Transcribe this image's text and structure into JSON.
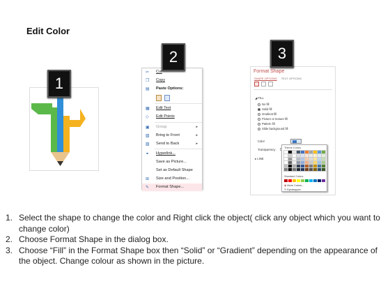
{
  "title": "Edit Color",
  "steps": [
    "1",
    "2",
    "3"
  ],
  "menu": {
    "items": [
      {
        "label": "Cut",
        "icon": "scissors-icon",
        "glyph": "✂",
        "style": "u"
      },
      {
        "label": "Copy",
        "icon": "copy-icon",
        "glyph": "❐",
        "style": "u"
      },
      {
        "label": "Paste Options:",
        "icon": "paste-icon",
        "glyph": "▤",
        "style": "title"
      },
      {
        "label": "Edit Text",
        "icon": "edit-text-icon",
        "glyph": "▦",
        "style": "u"
      },
      {
        "label": "Edit Points",
        "icon": "edit-points-icon",
        "glyph": "◇",
        "style": "u"
      },
      {
        "label": "Group",
        "icon": "group-icon",
        "glyph": "▣",
        "style": "dim",
        "arrow": true
      },
      {
        "label": "Bring to Front",
        "icon": "bring-to-front-icon",
        "glyph": "▧",
        "style": "",
        "arrow": true
      },
      {
        "label": "Send to Back",
        "icon": "send-to-back-icon",
        "glyph": "▨",
        "style": "",
        "arrow": true
      },
      {
        "label": "Hyperlink...",
        "icon": "hyperlink-icon",
        "glyph": "⚭",
        "style": "u"
      },
      {
        "label": "Save as Picture...",
        "icon": "",
        "glyph": "",
        "style": ""
      },
      {
        "label": "Set as Default Shape",
        "icon": "",
        "glyph": "",
        "style": ""
      },
      {
        "label": "Size and Position...",
        "icon": "size-position-icon",
        "glyph": "⊞",
        "style": ""
      },
      {
        "label": "Format Shape...",
        "icon": "format-shape-icon",
        "glyph": "✎",
        "style": "hl"
      }
    ]
  },
  "format_shape": {
    "title": "Format Shape",
    "tabs": [
      "SHAPE OPTIONS",
      "TEXT OPTIONS"
    ],
    "fill_header": "FILL",
    "fill_options": [
      "No fill",
      "Solid fill",
      "Gradient fill",
      "Picture or texture fill",
      "Pattern fill",
      "Slide background fill"
    ],
    "selected_fill": 1,
    "color_label": "Color",
    "transparency_label": "Transparency",
    "line_header": "LINE",
    "theme_colors_label": "Theme Colors",
    "standard_colors_label": "Standard Colors",
    "more_colors": "More Colors...",
    "eyedropper": "Eyedropper",
    "theme_top_row": [
      "#ffffff",
      "#000000",
      "#e7e6e6",
      "#44546a",
      "#4472c4",
      "#ed7d31",
      "#a5a5a5",
      "#ffc000",
      "#5b9bd5",
      "#70ad47"
    ],
    "standard_colors": [
      "#c00000",
      "#ff0000",
      "#ffc000",
      "#ffff00",
      "#92d050",
      "#00b050",
      "#00b0f0",
      "#0070c0",
      "#002060",
      "#7030a0"
    ]
  },
  "instructions": [
    {
      "num": "1.",
      "text": "Select the shape to change the color and Right click the object( click any object which you want to change color)"
    },
    {
      "num": "2.",
      "text": "Choose Format Shape in the dialog box."
    },
    {
      "num": "3.",
      "text": "Choose “Fill” in the Format Shape box then “Solid” or “Gradient” depending on the appearance of the object. Change colour as shown in the picture."
    }
  ],
  "colors": {
    "pencil_blue": "#2f8fd8",
    "pencil_green": "#5bb94a",
    "pencil_yellow": "#f5b21f",
    "accent_red": "#c0504d",
    "badge_bg": "#111111"
  }
}
